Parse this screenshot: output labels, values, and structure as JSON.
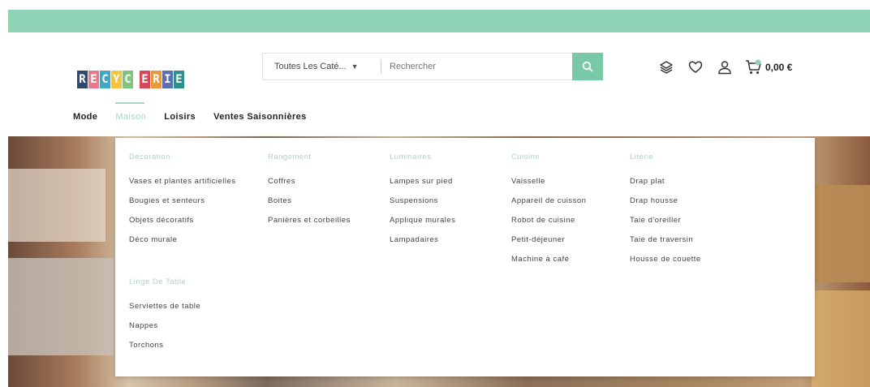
{
  "logo": {
    "letters": [
      {
        "ch": "R",
        "bg": "#2f4a6d"
      },
      {
        "ch": "E",
        "bg": "#e77a8e"
      },
      {
        "ch": "C",
        "bg": "#3fa7c6"
      },
      {
        "ch": "Y",
        "bg": "#f3c53a"
      },
      {
        "ch": "C",
        "bg": "#7fc67a"
      },
      {
        "ch": "E",
        "bg": "#d5475a"
      },
      {
        "ch": "R",
        "bg": "#e79a3b"
      },
      {
        "ch": "I",
        "bg": "#5b6fb3"
      },
      {
        "ch": "E",
        "bg": "#2f8f8a"
      }
    ]
  },
  "search": {
    "category": "Toutes Les Caté...",
    "placeholder": "Rechercher"
  },
  "cart": {
    "total": "0,00 €"
  },
  "nav": {
    "items": [
      "Mode",
      "Maison",
      "Loisirs",
      "Ventes Saisonnières"
    ],
    "active_index": 1
  },
  "mega": {
    "columns": [
      {
        "title": "Décoration",
        "links": [
          "Vases et plantes artificielles",
          "Bougies et senteurs",
          "Objets décoratifs",
          "Déco murale"
        ]
      },
      {
        "title": "Rangement",
        "links": [
          "Coffres",
          "Boites",
          "Panières et corbeilles"
        ]
      },
      {
        "title": "Luminaires",
        "links": [
          "Lampes sur pied",
          "Suspensions",
          "Applique murales",
          "Lampadaires"
        ]
      },
      {
        "title": "Cuisine",
        "links": [
          "Vaisselle",
          "Appareil de cuisson",
          "Robot de cuisine",
          "Petit-déjeuner",
          "Machine à café"
        ]
      },
      {
        "title": "Literie",
        "links": [
          "Drap plat",
          "Drap housse",
          "Taie d'oreiller",
          "Taie de traversin",
          "Housse de couette"
        ]
      }
    ],
    "linge": {
      "title": "Linge De Table",
      "links": [
        "Serviettes de table",
        "Nappes",
        "Torchons"
      ]
    }
  },
  "colors": {
    "accent": "#8fd3b6",
    "search_button": "#79c9a8",
    "menu_title": "#a7d8c3"
  }
}
